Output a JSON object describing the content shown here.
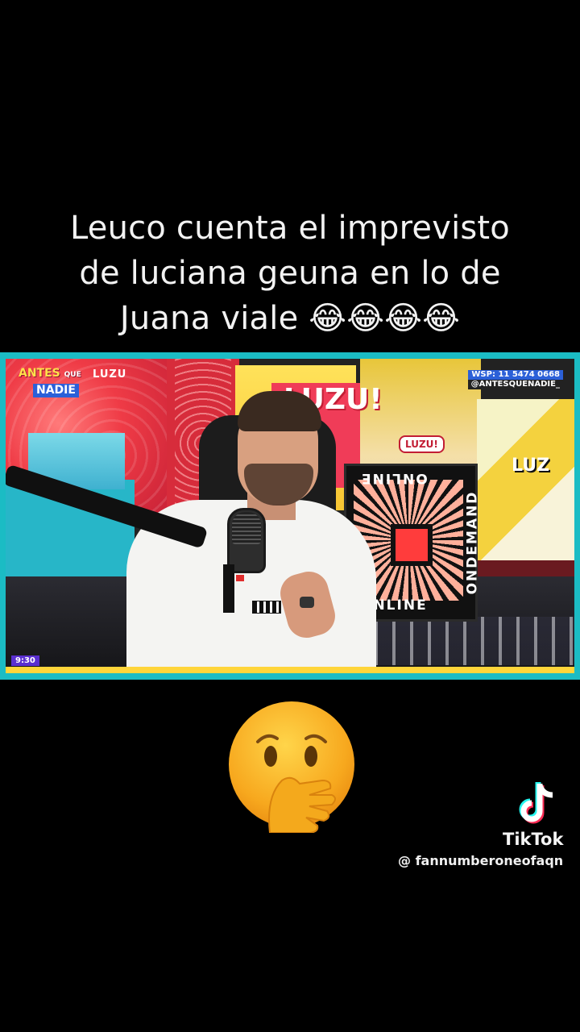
{
  "caption": {
    "line1": "Leuco cuenta el imprevisto",
    "line2": "de luciana geuna en lo de",
    "line3": "Juana viale 😂😂😂😂"
  },
  "video": {
    "show_logo_top": "ANTES",
    "show_logo_que": "QUE",
    "show_logo_bottom": "NADIE",
    "channel_brand": "LUZU",
    "phone_line": "WSP: 11 5474 0668",
    "handle_line": "@ANTESQUENADIE_",
    "time": "9:30",
    "set_sign": "LUZU!",
    "set_small_sign": "LUZU!",
    "set_right_sign": "LUZ",
    "ondemand_text": "ONDEMAND",
    "online_text": "ONLINE"
  },
  "reaction_emoji": "hand-over-mouth-face",
  "watermark": {
    "brand": "TikTok",
    "username": "@ fannumberoneofaqn"
  },
  "colors": {
    "frame_accent": "#1bbcc4",
    "time_badge": "#5a2fd0",
    "bottom_bar": "#ffd53a"
  }
}
